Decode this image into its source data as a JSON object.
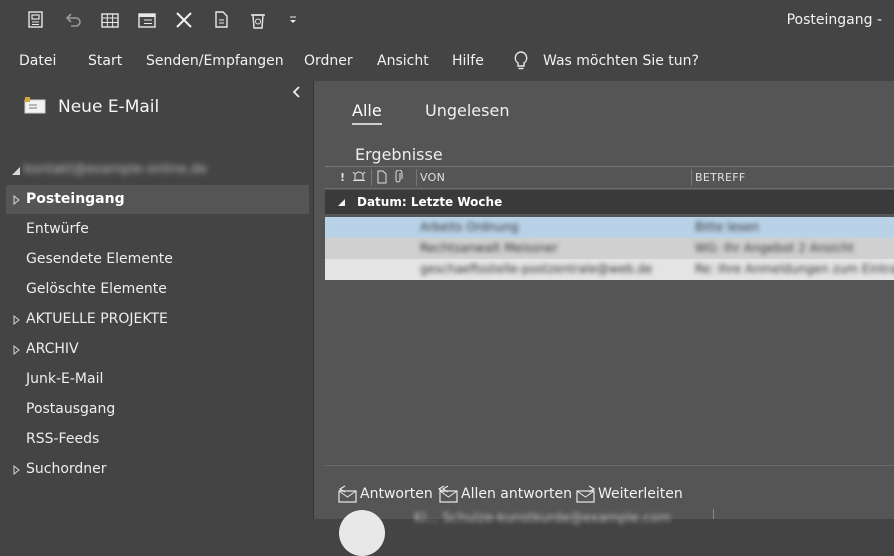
{
  "window": {
    "title": "Posteingang - "
  },
  "quick_access": [
    {
      "name": "send-receive-all-icon"
    },
    {
      "name": "undo-icon"
    },
    {
      "name": "grid-view-icon"
    },
    {
      "name": "calendar-view-icon"
    },
    {
      "name": "delete-icon"
    },
    {
      "name": "copy-icon"
    },
    {
      "name": "empty-recycle-icon"
    },
    {
      "name": "customize-toolbar-icon"
    }
  ],
  "menu": {
    "items": [
      "Datei",
      "Start",
      "Senden/Empfangen",
      "Ordner",
      "Ansicht",
      "Hilfe"
    ],
    "tell_me": "Was möchten Sie tun?"
  },
  "sidebar": {
    "new_mail": "Neue E-Mail",
    "account": "kontakt@example-online.de",
    "folders": [
      {
        "label": "Posteingang",
        "selected": true,
        "expandable": true
      },
      {
        "label": "Entwürfe",
        "selected": false,
        "expandable": false
      },
      {
        "label": "Gesendete Elemente",
        "selected": false,
        "expandable": false
      },
      {
        "label": "Gelöschte Elemente",
        "selected": false,
        "expandable": false
      },
      {
        "label": "AKTUELLE PROJEKTE",
        "selected": false,
        "expandable": true
      },
      {
        "label": "ARCHIV",
        "selected": false,
        "expandable": true
      },
      {
        "label": "Junk-E-Mail",
        "selected": false,
        "expandable": false
      },
      {
        "label": "Postausgang",
        "selected": false,
        "expandable": false
      },
      {
        "label": "RSS-Feeds",
        "selected": false,
        "expandable": false
      },
      {
        "label": "Suchordner",
        "selected": false,
        "expandable": true
      }
    ]
  },
  "mail_list": {
    "filters": {
      "all": "Alle",
      "unread": "Ungelesen"
    },
    "results_label": "Ergebnisse",
    "columns": {
      "importance": "!",
      "from": "VON",
      "subject": "BETREFF"
    },
    "group_label": "Datum: Letzte Woche",
    "rows": [
      {
        "from": "Arbeits Ordnung",
        "subject": "Bitte lesen",
        "color": "#b9d2e8"
      },
      {
        "from": "Rechtsanwalt Meissner",
        "subject": "WG: Ihr Angebot 2 Ansicht",
        "color": "#d0d0d0"
      },
      {
        "from": "geschaeftsstelle-postzentrale@web.de",
        "subject": "Re: Ihre Anmeldungen zum Eintrag",
        "color": "#e4e4e4"
      }
    ]
  },
  "reading": {
    "reply": "Antworten",
    "reply_all": "Allen antworten",
    "forward": "Weiterleiten",
    "sender": "Kl... Schulze-kunstkurde@example.com"
  },
  "colors": {
    "background": "#444444",
    "panel": "#555555",
    "selected": "#555555",
    "accent": "#b9d2e8"
  }
}
